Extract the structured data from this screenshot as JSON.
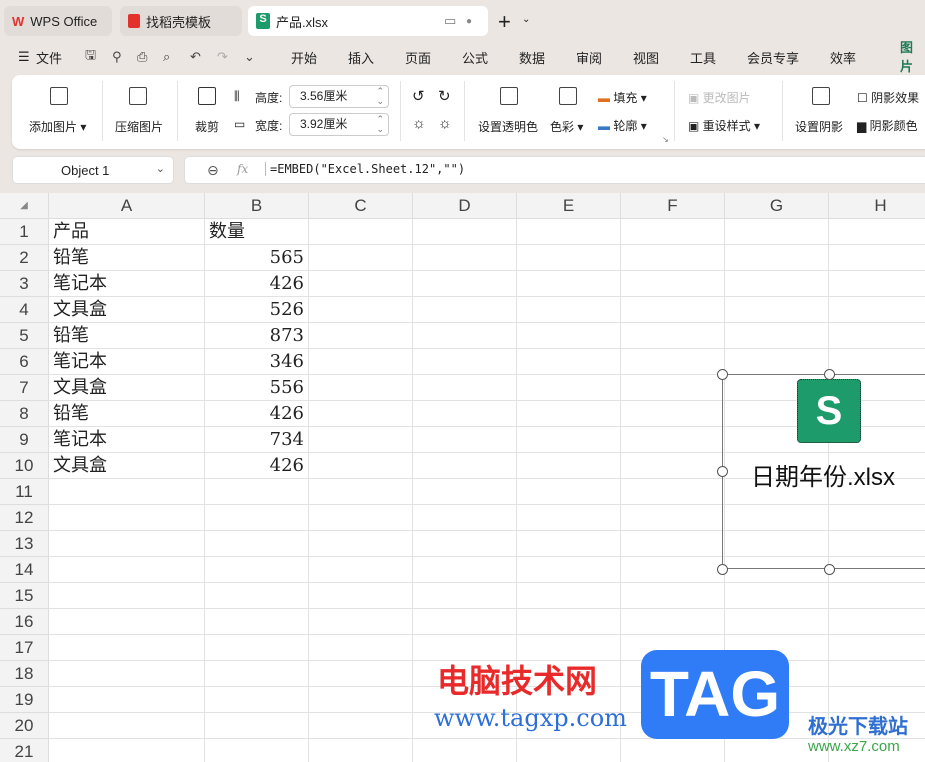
{
  "tabs": [
    {
      "label": "WPS Office"
    },
    {
      "label": "找稻壳模板"
    },
    {
      "label": "产品.xlsx"
    }
  ],
  "menu": {
    "file": "文件",
    "items": [
      "开始",
      "插入",
      "页面",
      "公式",
      "数据",
      "审阅",
      "视图",
      "工具",
      "会员专享",
      "效率",
      "图片"
    ]
  },
  "ribbon": {
    "add_picture": "添加图片",
    "compress": "压缩图片",
    "crop": "裁剪",
    "height_label": "高度:",
    "height_value": "3.56厘米",
    "width_label": "宽度:",
    "width_value": "3.92厘米",
    "transparent": "设置透明色",
    "color": "色彩",
    "fill": "填充",
    "outline": "轮廓",
    "change_picture": "更改图片",
    "reset_style": "重设样式",
    "shadow": "设置阴影",
    "shadow_effect": "阴影效果",
    "shadow_color": "阴影颜色"
  },
  "formula": {
    "name_box": "Object 1",
    "fx": "fx",
    "content": "=EMBED(\"Excel.Sheet.12\",\"\")"
  },
  "columns": [
    "A",
    "B",
    "C",
    "D",
    "E",
    "F",
    "G",
    "H"
  ],
  "rows": [
    [
      "产品",
      "数量"
    ],
    [
      "铅笔",
      "565"
    ],
    [
      "笔记本",
      "426"
    ],
    [
      "文具盒",
      "526"
    ],
    [
      "铅笔",
      "873"
    ],
    [
      "笔记本",
      "346"
    ],
    [
      "文具盒",
      "556"
    ],
    [
      "铅笔",
      "426"
    ],
    [
      "笔记本",
      "734"
    ],
    [
      "文具盒",
      "426"
    ]
  ],
  "row_count": 21,
  "embedded": {
    "icon_letter": "S",
    "filename": "日期年份.xlsx"
  },
  "watermark": {
    "site1": "电脑技术网",
    "url1": "www.tagxp.com",
    "tag": "TAG",
    "site2": "极光下载站",
    "url2": "www.xz7.com"
  }
}
